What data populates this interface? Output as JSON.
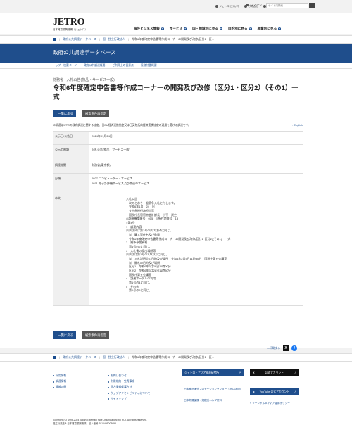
{
  "utility": {
    "items": [
      "ジェトロについて",
      "お問合せ",
      "Global Site",
      "アジア経済研究所"
    ],
    "mypage": "マイページ",
    "search_placeholder": "サイト内検索"
  },
  "header": {
    "logo_mark": "JETRO",
    "logo_sub": "日本貿易振興機構（ジェトロ）",
    "nav": [
      "海外ビジネス情報",
      "サービス",
      "国・地域別に見る",
      "目的別に見る",
      "産業別に見る"
    ]
  },
  "breadcrumb": [
    "政府公共調達データベース",
    "国・独立行政法人",
    "令和6年度確定申告書等作成コーナーの開発及び改修(区分1・区..."
  ],
  "banner_title": "政府公共調達データベース",
  "subnav": [
    "トップ・検索ページ",
    "政府公共調達概要",
    "ご利用上の留意点",
    "役務付番概要"
  ],
  "page": {
    "category": "財務省 - 入札公告(物品・サービス一般)",
    "title": "令和6年度確定申告書等作成コーナーの開発及び改修（区分1・区分2）（その1）一式",
    "back_label": "一覧に戻る",
    "cond_label": "検索条件再指定",
    "note": "本調達はWTOの政府調達に関する協定、日EU経済連携協定又は日英包括的経済連携協定の適用を受ける調達です。",
    "english_link": "English"
  },
  "info_table": {
    "rows": [
      {
        "k": "公示日/公告日",
        "v": [
          "2024年01月24日"
        ]
      },
      {
        "k": "公示の種類",
        "v": [
          "入札公告(物品・サービス一般)"
        ]
      },
      {
        "k": "調達機関",
        "v": [
          "財務省(東京都)"
        ]
      },
      {
        "k": "分類",
        "v": [
          "0027 コンピューター・サービス",
          "0071 電子計算機サービス及び関連のサービス"
        ]
      }
    ],
    "body_key": "本文",
    "body_lines": [
      "入札公告",
      "　次のとおり一般競争入札に付します。",
      "　令和6年1月　24　日",
      "　支出負担行為担当官",
      "　国税庁長官官房会計課長　小平　武史",
      "◎調達機関番号　015　◎所在地番号　13",
      "○第4号",
      "1　調達内容",
      "⑴⑵⑶⑷は第1号の⑴⑵⑶⑷に同じ。",
      "　⑸　購入等件名及び数量",
      "　令和6年度確定申告書等作成コーナーの開発及び改修(区分1･区分2)(その1)　一式",
      "2　競争参加資格",
      "　第1号の2に同じ。",
      "3　入札書の提出場所等",
      "⑴⑵⑶は第1号の3⑴⑵⑶に同じ。",
      "　⑷　入札説明会の日時及び場所　令和6年2月5日11時30分　国税庁第五会議室",
      "　⑸　開札の日時及び場所",
      "　区分1　令和6年3月28日11時00分",
      "　区分2　令和6年3月28日11時30分",
      "　国税庁第五会議室",
      "4　調達ポータルの利用",
      "　第1号の4に同じ。",
      "5　その他",
      "　第1号の5に同じ。"
    ]
  },
  "share": {
    "print_label": "印刷する",
    "x": "X",
    "fb": "f"
  },
  "footer": {
    "col1": [
      "採用情報",
      "調達情報",
      "情報公開"
    ],
    "col2": [
      "お問い合わせ",
      "利用規約・免責事項",
      "個人情報保護方針",
      "ウェブアクセシビリティについて",
      "サイトマップ"
    ],
    "btn_asia": "ジェトロ・アジア経済研究所",
    "link1": "日本食品海外プロモーションセンター（JFOODO）",
    "link2": "日本貿易保険・規模別ヘルプ窓口",
    "btn_x": "公式アカウント",
    "btn_yt": "YouTube 公式アカウント",
    "link3": "ソーシャルメディア運用ポリシー",
    "copyright1": "Copyright (C) 1995-2024 Japan External Trade Organization(JETRO). All rights reserved.",
    "copyright2": "独立行政法人日本貿易振興機構　法人番号 2010405003693"
  }
}
